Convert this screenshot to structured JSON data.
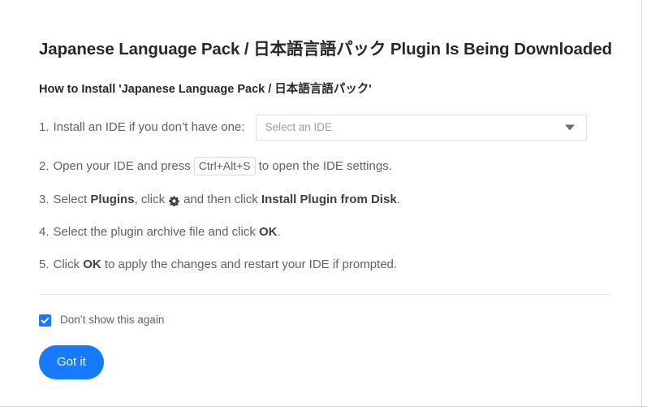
{
  "page": {
    "title": "Japanese Language Pack / 日本語言語パック Plugin Is Being Downloaded",
    "howto_title": "How to Install 'Japanese Language Pack / 日本語言語パック'"
  },
  "steps": {
    "step1": {
      "number": "1.",
      "text": "Install an IDE if you don’t have one:"
    },
    "step2": {
      "number": "2.",
      "before": "Open your IDE and press",
      "shortcut": "Ctrl+Alt+S",
      "after": "to open the IDE settings."
    },
    "step3": {
      "number": "3.",
      "before": "Select",
      "bold1": "Plugins",
      "middle": ", click",
      "icon": "gear-icon",
      "middle2": "and then click",
      "bold2": "Install Plugin from Disk",
      "after": "."
    },
    "step4": {
      "number": "4.",
      "before": "Select the plugin archive file and click",
      "bold1": "OK",
      "after": "."
    },
    "step5": {
      "number": "5.",
      "before": "Click",
      "bold1": "OK",
      "after": "to apply the changes and restart your IDE if prompted."
    }
  },
  "ide_select": {
    "placeholder": "Select an IDE",
    "value": "",
    "chevron": "chevron-down-icon"
  },
  "dont_show": {
    "label": "Don’t show this again",
    "checked": true
  },
  "primary_button": {
    "label": "Got it"
  },
  "colors": {
    "accent": "#177bff",
    "checkbox": "#1a7aff",
    "title": "#27282b",
    "body_text": "#5c6469",
    "placeholder": "#9aa0a6",
    "border": "#dfe1e5",
    "divider": "#e6e7e9"
  }
}
